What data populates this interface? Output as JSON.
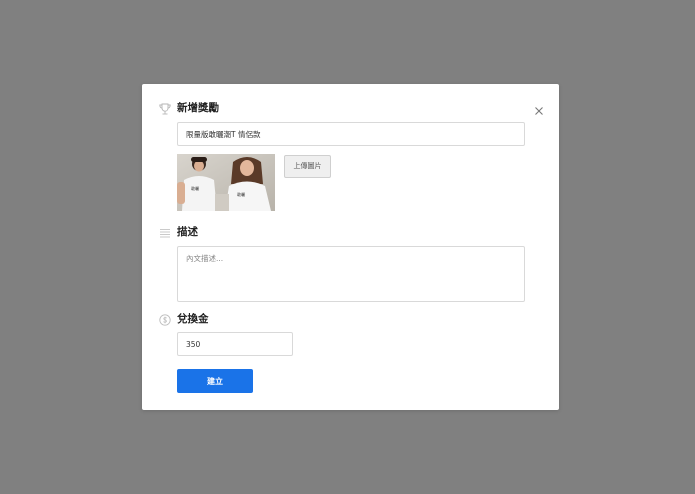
{
  "modal": {
    "title": "新增獎勵",
    "close_icon": "close-icon",
    "reward": {
      "icon": "trophy-icon",
      "name_value": "限量版敢曬潮T 情侶款",
      "upload_label": "上傳圖片"
    },
    "description": {
      "icon": "list-icon",
      "title": "描述",
      "placeholder": "內文描述..."
    },
    "exchange": {
      "icon": "coin-icon",
      "title": "兌換金",
      "value": "350"
    },
    "submit_label": "建立"
  },
  "colors": {
    "backdrop": "#808080",
    "primary": "#1a73e8",
    "border": "#d9d9d9"
  }
}
